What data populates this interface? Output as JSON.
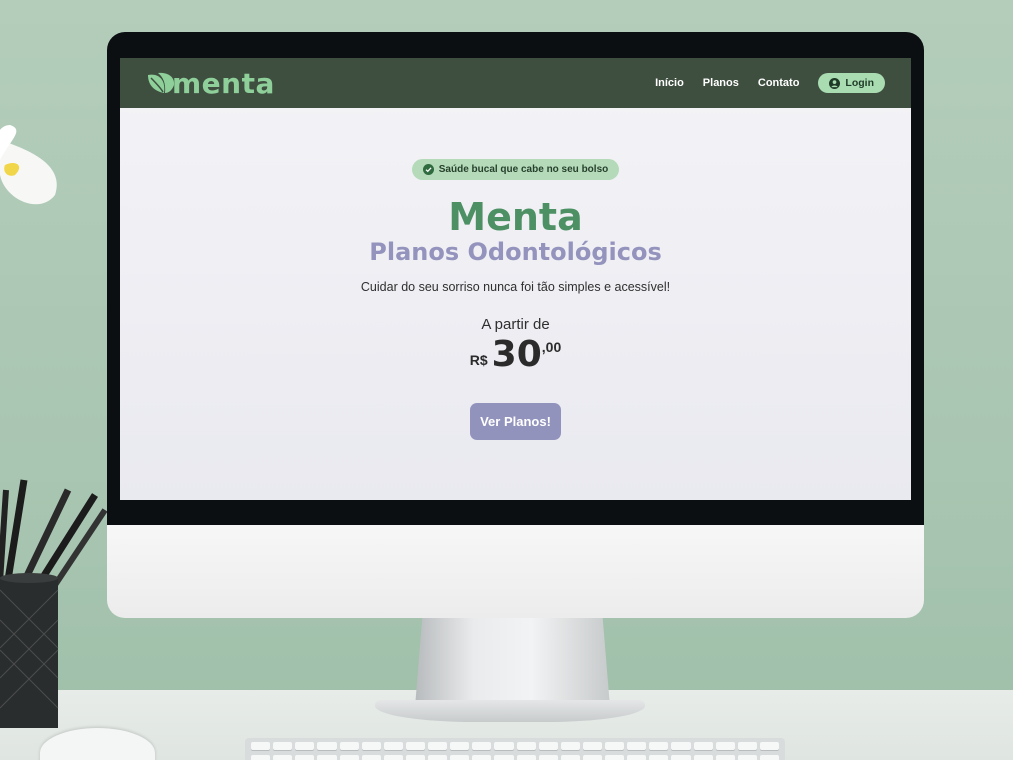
{
  "header": {
    "logo_text": "menta",
    "nav": {
      "inicio": "Início",
      "planos": "Planos",
      "contato": "Contato",
      "login": "Login"
    }
  },
  "hero": {
    "badge": "Saúde bucal que cabe no seu bolso",
    "title": "Menta",
    "subtitle": "Planos Odontológicos",
    "tagline": "Cuidar do seu sorriso nunca foi tão simples e acessível!",
    "price_intro": "A partir de",
    "price": {
      "currency": "R$",
      "amount": "30",
      "cents": ",00"
    },
    "cta": "Ver Planos!"
  },
  "colors": {
    "nav_bg": "#3e4f3f",
    "brand_green": "#4c9064",
    "logo_green": "#8ecf9a",
    "accent_lavender": "#9293bd",
    "badge_bg": "#b4dab9",
    "wall": "#aac7b3"
  },
  "icons": {
    "logo": "leaf-icon",
    "badge": "check-circle-icon",
    "login": "user-circle-icon"
  }
}
